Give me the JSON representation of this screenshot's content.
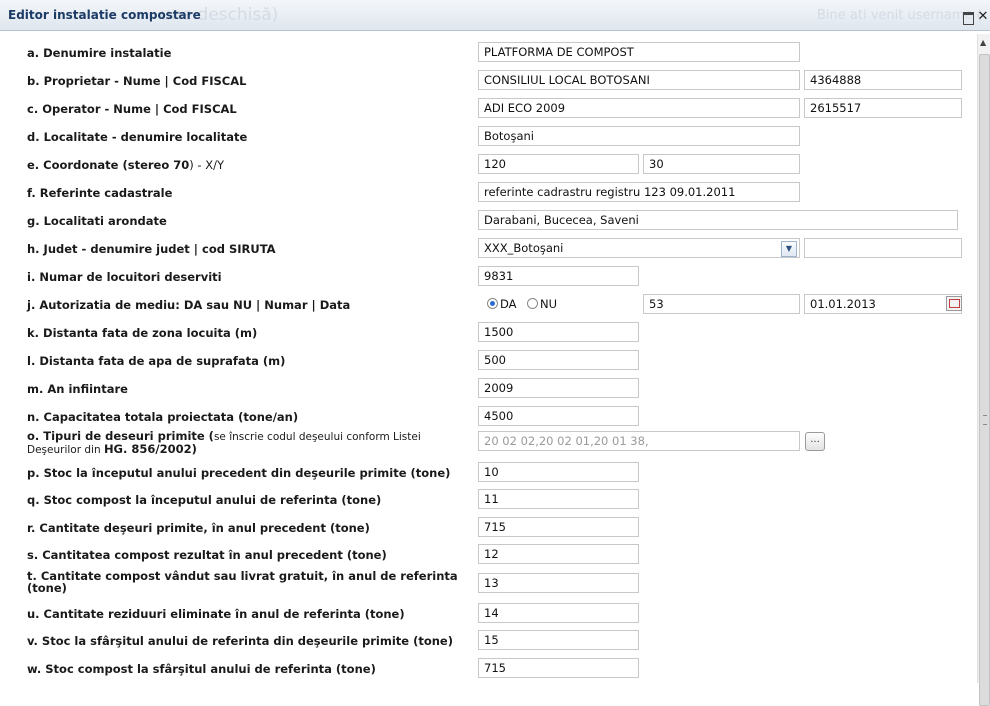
{
  "window": {
    "title": "Editor instalatie compostare",
    "ghost_text": "une deschisă)",
    "ghost_text_right": "Bine ati venit username (",
    "maximize_icon": "maximize-icon",
    "close_icon": "close-icon"
  },
  "fields": {
    "a": {
      "label": "a. Denumire instalatie",
      "value": "PLATFORMA DE COMPOST"
    },
    "b": {
      "label": "b. Proprietar - Nume | Cod FISCAL",
      "value": "CONSILIUL LOCAL BOTOSANI",
      "value2": "4364888"
    },
    "c": {
      "label": "c. Operator - Nume | Cod FISCAL",
      "value": "ADI ECO 2009",
      "value2": "2615517"
    },
    "d": {
      "label": "d. Localitate - denumire localitate",
      "value": "Botoşani"
    },
    "e": {
      "label_bold": "e. Coordonate (stereo 70",
      "label_rest": ") - X/Y",
      "value": "120",
      "value2": "30"
    },
    "f": {
      "label": "f. Referinte cadastrale",
      "value": "referinte cadrastru registru 123 09.01.2011"
    },
    "g": {
      "label": "g. Localitati arondate",
      "value": "Darabani, Bucecea, Saveni"
    },
    "h": {
      "label": "h. Judet - denumire judet | cod SIRUTA",
      "value": "XXX_Botoşani",
      "value2": ""
    },
    "i": {
      "label": "i. Numar de locuitori deserviti",
      "value": "9831"
    },
    "j": {
      "label": "j. Autorizatia de mediu: DA sau NU | Numar | Data",
      "radio_da": "DA",
      "radio_nu": "NU",
      "selected": "DA",
      "numar": "53",
      "data": "01.01.2013"
    },
    "k": {
      "label": "k. Distanta fata de zona locuita (m)",
      "value": "1500"
    },
    "l": {
      "label": "l. Distanta fata de apa de suprafata (m)",
      "value": "500"
    },
    "m": {
      "label": "m. An infiintare",
      "value": "2009"
    },
    "n": {
      "label": "n. Capacitatea totala proiectata (tone/an)",
      "value": "4500"
    },
    "o": {
      "label_bold": "o. Tipuri de deseuri primite (",
      "label_note": "se înscrie codul deşeului conform Listei Deşeurilor din ",
      "label_ref": "HG. 856/2002)",
      "value": "20 02 02,20 02 01,20 01 38,",
      "button": "..."
    },
    "p": {
      "label": "p. Stoc la începutul anului precedent din deşeurile primite (tone)",
      "value": "10"
    },
    "q": {
      "label": "q. Stoc compost la începutul anului de referinta (tone)",
      "value": "11"
    },
    "r": {
      "label": "r. Cantitate deşeuri primite, în anul precedent (tone)",
      "value": "715"
    },
    "s": {
      "label": "s. Cantitatea compost rezultat în anul precedent (tone)",
      "value": "12"
    },
    "t": {
      "label": "t. Cantitate compost vândut sau livrat gratuit, în anul de referinta (tone)",
      "value": "13"
    },
    "u": {
      "label": "u. Cantitate reziduuri eliminate în anul de referinta (tone)",
      "value": "14"
    },
    "v": {
      "label": "v. Stoc la sfârşitul anului de referinta din deşeurile primite (tone)",
      "value": "15"
    },
    "w": {
      "label": "w. Stoc compost la sfârşitul anului de referinta (tone)",
      "value": "715"
    }
  },
  "icons": {
    "select": "chevron-down-icon",
    "calendar": "calendar-icon"
  }
}
